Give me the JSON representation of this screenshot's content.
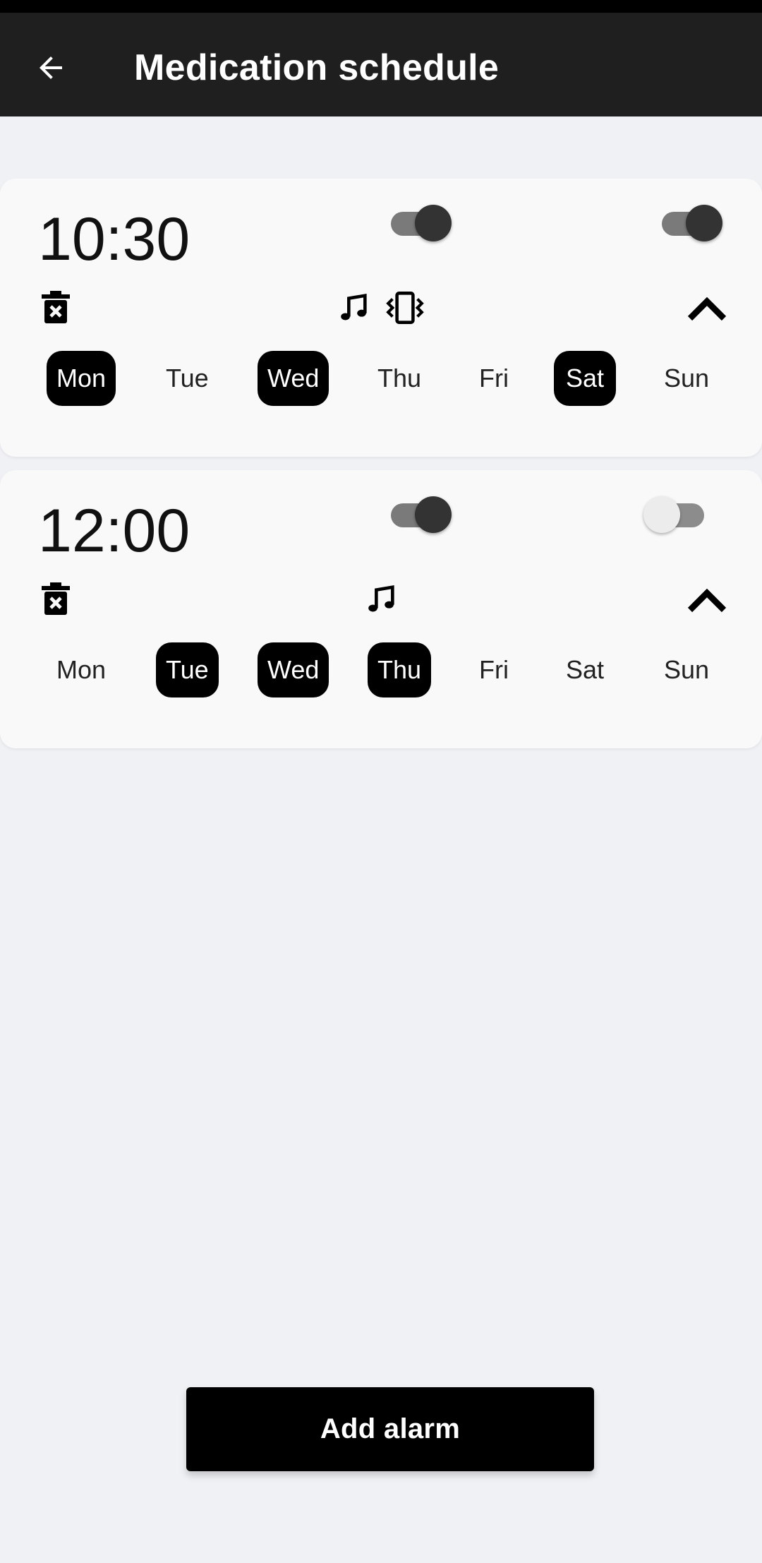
{
  "app_bar": {
    "title": "Medication schedule",
    "back_icon": "arrow-left-icon"
  },
  "alarms": [
    {
      "time": "10:30",
      "enabled": true,
      "secondary_enabled": true,
      "icons": [
        "delete-icon",
        "music-note-icon",
        "vibrate-icon",
        "chevron-up-icon"
      ],
      "days": [
        {
          "label": "Mon",
          "selected": true
        },
        {
          "label": "Tue",
          "selected": false
        },
        {
          "label": "Wed",
          "selected": true
        },
        {
          "label": "Thu",
          "selected": false
        },
        {
          "label": "Fri",
          "selected": false
        },
        {
          "label": "Sat",
          "selected": true
        },
        {
          "label": "Sun",
          "selected": false
        }
      ]
    },
    {
      "time": "12:00",
      "enabled": true,
      "secondary_enabled": false,
      "icons": [
        "delete-icon",
        "music-note-icon",
        "chevron-up-icon"
      ],
      "days": [
        {
          "label": "Mon",
          "selected": false
        },
        {
          "label": "Tue",
          "selected": true
        },
        {
          "label": "Wed",
          "selected": true
        },
        {
          "label": "Thu",
          "selected": true
        },
        {
          "label": "Fri",
          "selected": false
        },
        {
          "label": "Sat",
          "selected": false
        },
        {
          "label": "Sun",
          "selected": false
        }
      ]
    }
  ],
  "add_alarm_label": "Add alarm",
  "colors": {
    "app_bar": "#1f1f1f",
    "background": "#eff1f5",
    "card": "#f9f9f9",
    "selected_day": "#000000",
    "primary_button": "#000000"
  }
}
